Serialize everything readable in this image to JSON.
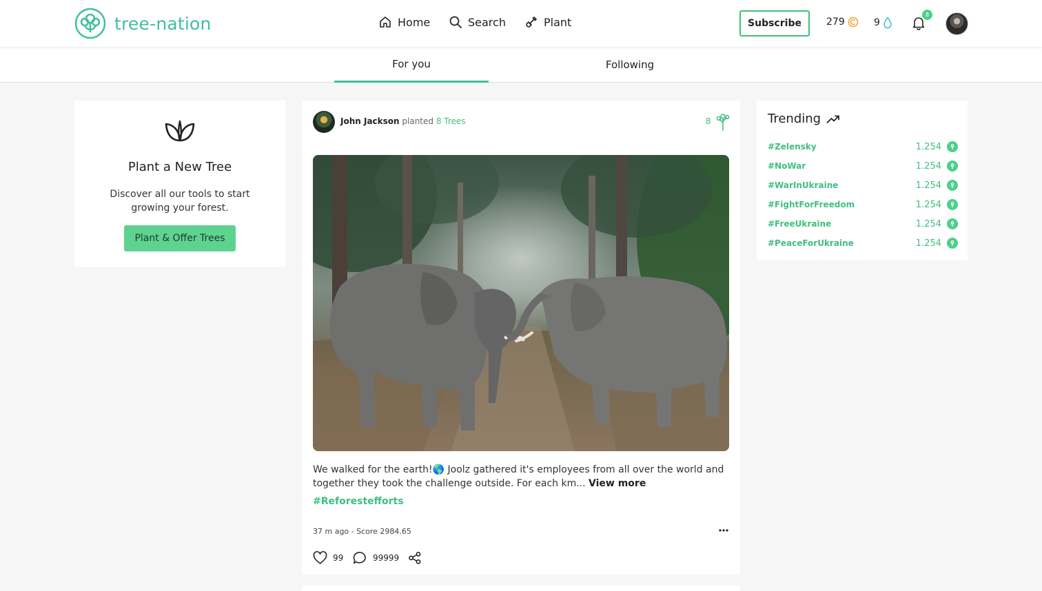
{
  "brand": {
    "name": "tree-nation",
    "color": "#3fbf9f"
  },
  "nav": {
    "home": "Home",
    "search": "Search",
    "plant": "Plant"
  },
  "header": {
    "subscribe": "Subscribe",
    "coins": "279",
    "drops": "9",
    "notif_badge": "8"
  },
  "tabs": {
    "for_you": "For you",
    "following": "Following"
  },
  "plant_card": {
    "title": "Plant a New Tree",
    "description": "Discover all our tools to start growing your forest.",
    "button": "Plant & Offer Trees"
  },
  "post": {
    "author": "John Jackson",
    "verb": "planted",
    "trees_label": "8 Trees",
    "tree_count": "8",
    "text": "We walked for the earth!🌎 Joolz gathered it's employees from all over the world and together they took the challenge outside. For each km...",
    "view_more": "View more",
    "hashtag": "#Reforestefforts",
    "time": "37 m ago -",
    "score": "Score 2984.65",
    "likes": "99",
    "comments": "99999"
  },
  "trending": {
    "title": "Trending",
    "items": [
      {
        "tag": "#Zelensky",
        "count": "1.254"
      },
      {
        "tag": "#NoWar",
        "count": "1.254"
      },
      {
        "tag": "#WarInUkraine",
        "count": "1.254"
      },
      {
        "tag": "#FightForFreedom",
        "count": "1.254"
      },
      {
        "tag": "#FreeUkraine",
        "count": "1.254"
      },
      {
        "tag": "#PeaceForUkraine",
        "count": "1.254"
      }
    ]
  },
  "colors": {
    "accent": "#3fbf7f",
    "button": "#5ed38f",
    "coin": "#f0a030",
    "drop": "#3fbfbf"
  }
}
